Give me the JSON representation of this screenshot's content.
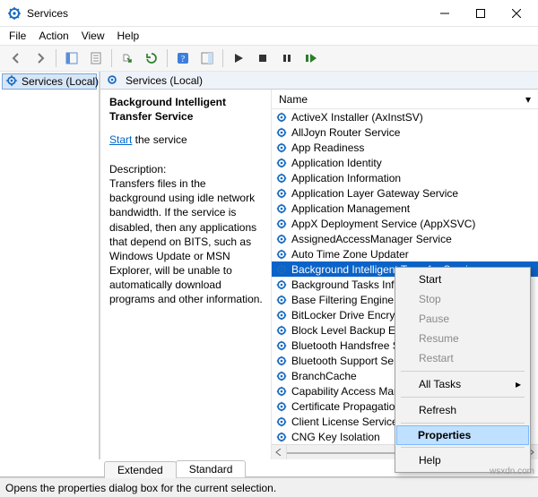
{
  "window": {
    "title": "Services"
  },
  "menu": {
    "file": "File",
    "action": "Action",
    "view": "View",
    "help": "Help"
  },
  "tree": {
    "root": "Services (Local)"
  },
  "loc_header": {
    "title": "Services (Local)"
  },
  "info": {
    "selected_name": "Background Intelligent Transfer Service",
    "start_link": "Start",
    "start_suffix": " the service",
    "desc_label": "Description:",
    "desc": "Transfers files in the background using idle network bandwidth. If the service is disabled, then any applications that depend on BITS, such as Windows Update or MSN Explorer, will be unable to automatically download programs and other information."
  },
  "columns": {
    "name": "Name"
  },
  "services": [
    "ActiveX Installer (AxInstSV)",
    "AllJoyn Router Service",
    "App Readiness",
    "Application Identity",
    "Application Information",
    "Application Layer Gateway Service",
    "Application Management",
    "AppX Deployment Service (AppXSVC)",
    "AssignedAccessManager Service",
    "Auto Time Zone Updater",
    "Background Intelligent Transfer Service",
    "Background Tasks Infrastructure Service",
    "Base Filtering Engine",
    "BitLocker Drive Encryption Service",
    "Block Level Backup Engine",
    "Bluetooth Handsfree Service",
    "Bluetooth Support Service",
    "BranchCache",
    "Capability Access Manager",
    "Certificate Propagation",
    "Client License Service (ClipSVC)",
    "CNG Key Isolation"
  ],
  "selected_index": 10,
  "tabs": {
    "extended": "Extended",
    "standard": "Standard"
  },
  "context_menu": {
    "start": "Start",
    "stop": "Stop",
    "pause": "Pause",
    "resume": "Resume",
    "restart": "Restart",
    "all_tasks": "All Tasks",
    "refresh": "Refresh",
    "properties": "Properties",
    "help": "Help"
  },
  "status_text": "Opens the properties dialog box for the current selection.",
  "watermark": "wsxdn.com"
}
